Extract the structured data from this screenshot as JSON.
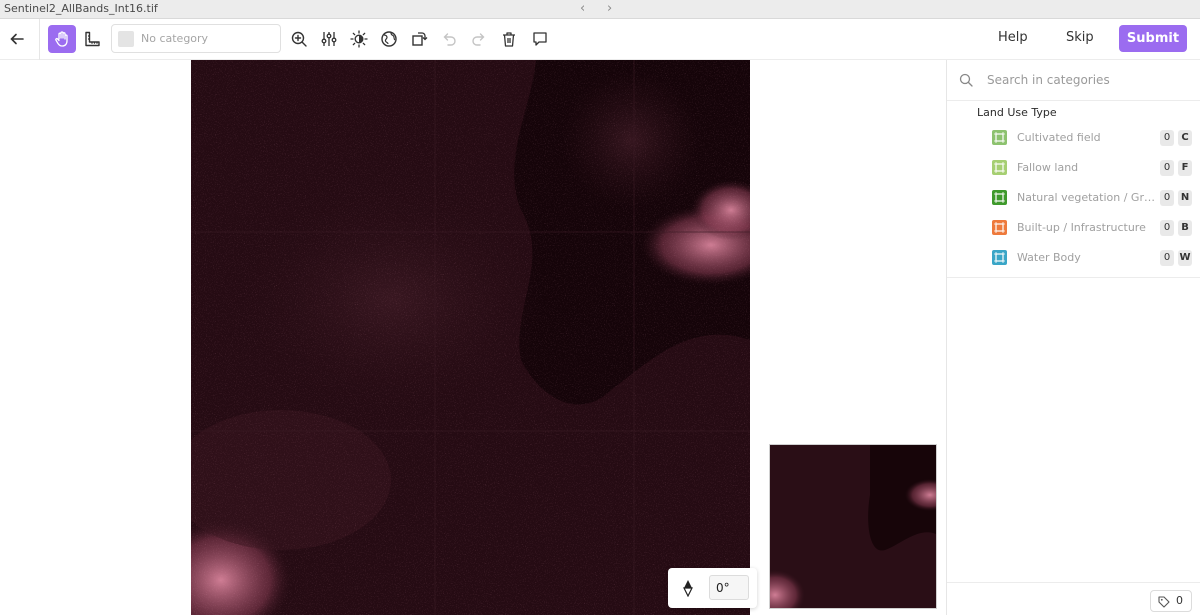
{
  "window": {
    "file_name": "Sentinel2_AllBands_Int16.tif",
    "nav_back": "‹",
    "nav_forward": "›"
  },
  "toolbar": {
    "category_placeholder": "No category",
    "help_label": "Help",
    "skip_label": "Skip",
    "submit_label": "Submit",
    "accent_color": "#9b6cf0"
  },
  "viewer": {
    "rotation": "0°"
  },
  "sidebar": {
    "search_placeholder": "Search in categories",
    "group_title": "Land Use Type",
    "categories": [
      {
        "label": "Cultivated field",
        "count": "0",
        "key": "C",
        "color": "#8dc26f"
      },
      {
        "label": "Fallow land",
        "count": "0",
        "key": "F",
        "color": "#a6cf72"
      },
      {
        "label": "Natural vegetation / Grassland",
        "count": "0",
        "key": "N",
        "color": "#3f9a2c"
      },
      {
        "label": "Built-up / Infrastructure",
        "count": "0",
        "key": "B",
        "color": "#ee7a3c"
      },
      {
        "label": "Water Body",
        "count": "0",
        "key": "W",
        "color": "#3aa6c7"
      }
    ],
    "annotation_count": "0"
  }
}
